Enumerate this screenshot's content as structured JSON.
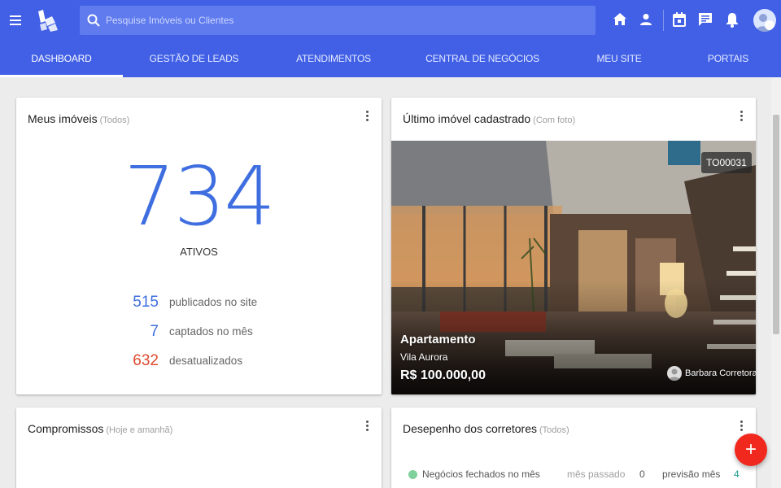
{
  "header": {
    "search_placeholder": "Pesquise Imóveis ou Clientes",
    "icons": [
      "menu-icon",
      "home-icon",
      "person-icon",
      "calendar-icon",
      "chat-icon",
      "bell-icon",
      "avatar"
    ],
    "brand_color": "#4160e6"
  },
  "tabs": [
    {
      "label": "DASHBOARD",
      "active": true
    },
    {
      "label": "GESTÃO DE LEADS"
    },
    {
      "label": "ATENDIMENTOS"
    },
    {
      "label": "CENTRAL DE NEGÓCIOS"
    },
    {
      "label": "MEU SITE"
    },
    {
      "label": "PORTAIS"
    }
  ],
  "meus_imoveis": {
    "title": "Meus imóveis",
    "subtitle": "(Todos)",
    "total": "734",
    "total_label": "ATIVOS",
    "stats": [
      {
        "value": "515",
        "label": "publicados no site",
        "color": "#3f6ee0"
      },
      {
        "value": "7",
        "label": "captados no mês",
        "color": "#3f6ee0"
      },
      {
        "value": "632",
        "label": "desatualizados",
        "color": "#e04a2f"
      }
    ]
  },
  "ultimo_imovel": {
    "title": "Último imóvel cadastrado",
    "subtitle": "(Com foto)",
    "code": "TO00031",
    "type": "Apartamento",
    "neighborhood": "Vila Aurora",
    "price": "R$ 100.000,00",
    "agent": "Barbara Corretora"
  },
  "compromissos": {
    "title": "Compromissos",
    "subtitle": "(Hoje e amanhã)"
  },
  "desempenho": {
    "title": "Desepenho dos corretores",
    "subtitle": "(Todos)",
    "row": {
      "label": "Negócios fechados no mês",
      "prev_label": "mês passado",
      "prev_value": "0",
      "forecast_label": "previsão mês",
      "forecast_value": "4"
    }
  },
  "fab_label": "+"
}
